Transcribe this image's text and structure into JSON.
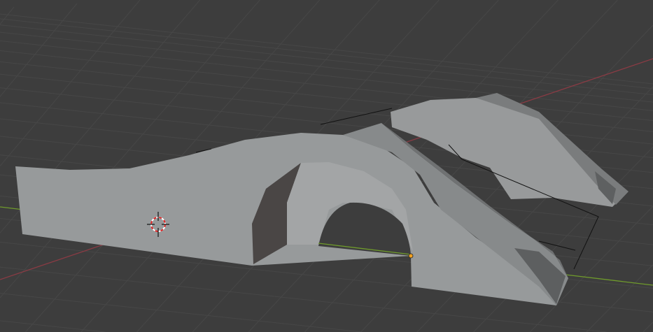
{
  "viewport": {
    "mode": "3d-viewport",
    "colors": {
      "background": "#3d3d3d",
      "grid": "#474747",
      "x_axis": "#8a3b44",
      "y_axis": "#6f9a2c",
      "mesh_light": "#989a9b",
      "mesh_mid": "#868889",
      "mesh_dark": "#6e7071",
      "mesh_shadow": "#4a4645",
      "origin_dot": "#f0a020"
    },
    "icons": [
      "3d-cursor-icon",
      "object-origin-icon"
    ]
  }
}
